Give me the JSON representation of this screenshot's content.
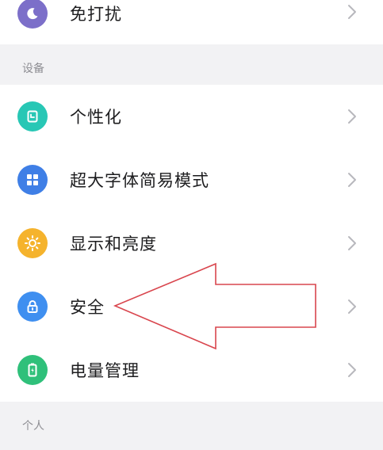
{
  "top_item": {
    "label": "免打扰",
    "icon": "moon-icon",
    "color": "#7c6fc9"
  },
  "sections": [
    {
      "header": "设备",
      "items": [
        {
          "label": "个性化",
          "icon": "personalize-icon",
          "color": "#28c7b5"
        },
        {
          "label": "超大字体简易模式",
          "icon": "grid-icon",
          "color": "#3f7fe6"
        },
        {
          "label": "显示和亮度",
          "icon": "sun-icon",
          "color": "#f5b32d"
        },
        {
          "label": "安全",
          "icon": "lock-icon",
          "color": "#3f8ff0"
        },
        {
          "label": "电量管理",
          "icon": "battery-icon",
          "color": "#2fc07a"
        }
      ]
    },
    {
      "header": "个人"
    }
  ],
  "annotation": {
    "type": "arrow",
    "pointing_to": "安全",
    "color": "#d9464e"
  }
}
